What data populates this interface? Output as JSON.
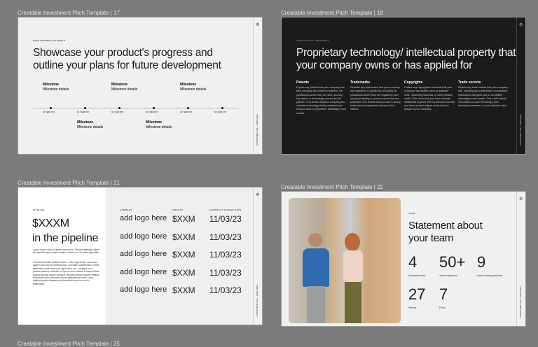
{
  "slides": [
    {
      "label": "Creatable Investment Pitch Template | 17",
      "kicker": "Development roadmap",
      "title": "Showcase your product's progress and outline your plans for future development",
      "milestone_title": "Milestone",
      "milestone_details": "Milestone details",
      "quarter": "Q1 YEAR XXX",
      "confidential": "CONFIDENTIAL | FEB 2023"
    },
    {
      "label": "Creatable Investment Pitch Template | 18",
      "kicker": "Intellectual property",
      "title": "Proprietary technology/ intellectual property that your company owns or has applied for",
      "columns": [
        {
          "title": "Patents",
          "text": "Explain any patents that your company has filed, including the number of patents, the jurisdictions where they are filed, and any key claims or technology covered by the patents. This shows that your company has valuable technology that is protected and that you have a competitive advantage in the market."
        },
        {
          "title": "Trademarks",
          "text": "Describe any trademarks that your company has registered or applied for, including the jurisdictions where they are registered, and any key branding or product names that are protected. This shows that you have a strong brand and a recognized presence in the market."
        },
        {
          "title": "Copyrights",
          "text": "Outline any copyrighted materials that your company has created, such as software code, marketing materials, or other creative works. This shows that you have valuable intellectual property that is protected and that you have created original works that are unique to your company."
        },
        {
          "title": "Trade secrets",
          "text": "Explain any trade secrets that your company has, including any confidential or proprietary information that gives you a competitive advantage in the market. This could include information on your technology, your business processes, or your customer data."
        }
      ],
      "confidential": "CONFIDENTIAL | FEB 2023"
    },
    {
      "label": "Creatable Investment Pitch Template | 21",
      "kicker": "Pipeline",
      "title_line1": "$XXXM",
      "title_line2": "in the pipeline",
      "para1": "Lorem ipsum dolor sit amet consectetur. Tristique egestas nullam sit imperdiet eget mauris ornare. Laoreet eu orci lacus imperdiet.",
      "para2": "Pharetra molestie facilisis ultrices. Tellus eget lectus maecenas sapien dolor cursus pellentesque. Convallis condimentum ornare venenatis morbi massa dui eget varius nisi. Curabitur urna gravida mauris in tincidunt vel purus nunc massa. A massa tellus massa egestas dictum tincidunt. Neque pulvinar posuere fringilla fermentum sem consectetur enim pellentesque diam. Nunc adipiscing quis aliquam porta tincidunt lectus non nisi in. Malesuada.",
      "headers": [
        "Company",
        "Amount",
        "Contract signed date"
      ],
      "rows": [
        [
          "add logo here",
          "$XXM",
          "11/03/23"
        ],
        [
          "add logo here",
          "$XXM",
          "11/03/23"
        ],
        [
          "add logo here",
          "$XXM",
          "11/03/23"
        ],
        [
          "add logo here",
          "$XXM",
          "11/03/23"
        ],
        [
          "add logo here",
          "$XXM",
          "11/03/23"
        ]
      ],
      "confidential": "CONFIDENTIAL | FEB 2023"
    },
    {
      "label": "Creatable Investment Pitch Template | 22",
      "kicker": "Team",
      "title": "Statement about your team",
      "stats": [
        {
          "value": "4",
          "caption": "Successful exits"
        },
        {
          "value": "50+",
          "caption": "Years experience"
        },
        {
          "value": "9",
          "caption": "Award-winning products"
        },
        {
          "value": "27",
          "caption": "Patents"
        },
        {
          "value": "7",
          "caption": "PhDs"
        }
      ],
      "confidential": "CONFIDENTIAL | FEB 2023"
    },
    {
      "label": "Creatable Investment Pitch Template | 25"
    }
  ],
  "colors": {
    "canvas": "#7b7b7b",
    "light_slide": "#f0f0f0",
    "dark_slide": "#1b1b1b"
  }
}
